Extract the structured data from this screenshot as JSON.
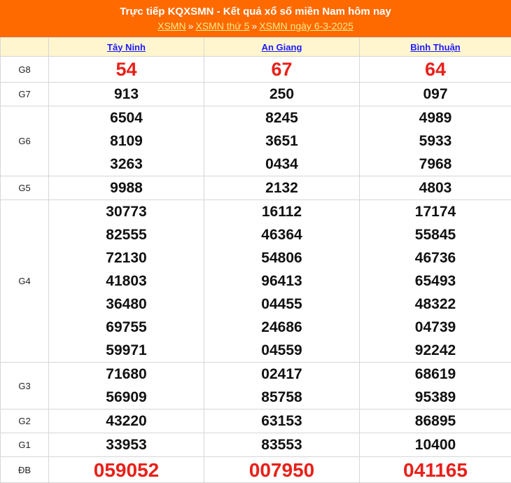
{
  "header": {
    "title": "Trực tiếp KQXSMN - Kết quả xổ số miền Nam hôm nay",
    "crumbs": [
      "XSMN",
      "XSMN thứ 5",
      "XSMN ngày 6-3-2025"
    ],
    "separator": "»",
    "colors": {
      "background": "#ff6a00",
      "link": "#ffe98a"
    }
  },
  "provinces": [
    "Tây Ninh",
    "An Giang",
    "Bình Thuận"
  ],
  "prizes": [
    {
      "label": "G8",
      "values": [
        [
          "54"
        ],
        [
          "67"
        ],
        [
          "64"
        ]
      ]
    },
    {
      "label": "G7",
      "values": [
        [
          "913"
        ],
        [
          "250"
        ],
        [
          "097"
        ]
      ]
    },
    {
      "label": "G6",
      "values": [
        [
          "6504",
          "8109",
          "3263"
        ],
        [
          "8245",
          "3651",
          "0434"
        ],
        [
          "4989",
          "5933",
          "7968"
        ]
      ]
    },
    {
      "label": "G5",
      "values": [
        [
          "9988"
        ],
        [
          "2132"
        ],
        [
          "4803"
        ]
      ]
    },
    {
      "label": "G4",
      "values": [
        [
          "30773",
          "82555",
          "72130",
          "41803",
          "36480",
          "69755",
          "59971"
        ],
        [
          "16112",
          "46364",
          "54806",
          "96413",
          "04455",
          "24686",
          "04559"
        ],
        [
          "17174",
          "55845",
          "46736",
          "65493",
          "48322",
          "04739",
          "92242"
        ]
      ]
    },
    {
      "label": "G3",
      "values": [
        [
          "71680",
          "56909"
        ],
        [
          "02417",
          "85758"
        ],
        [
          "68619",
          "95389"
        ]
      ]
    },
    {
      "label": "G2",
      "values": [
        [
          "43220"
        ],
        [
          "63153"
        ],
        [
          "86895"
        ]
      ]
    },
    {
      "label": "G1",
      "values": [
        [
          "33953"
        ],
        [
          "83553"
        ],
        [
          "10400"
        ]
      ]
    },
    {
      "label": "ĐB",
      "values": [
        [
          "059052"
        ],
        [
          "007950"
        ],
        [
          "041165"
        ]
      ]
    }
  ],
  "colors": {
    "highlight": "#e8201a",
    "header_row": "#fff6cf",
    "province_link": "#1a1aff"
  }
}
